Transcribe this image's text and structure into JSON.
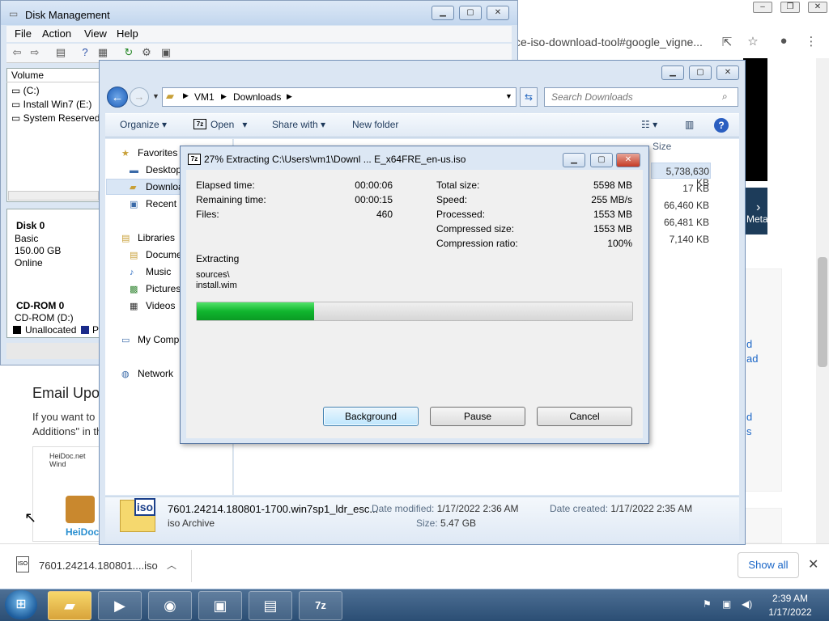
{
  "chrome": {
    "omnibox_text": "ce-iso-download-tool#google_vigne...",
    "email_heading": "Email Upo",
    "email_p1": "If you want to",
    "email_p2": "Additions\" in th",
    "heidoc_label": "HeiDoc.net Wind",
    "heidoc_logo": "HeiDoc",
    "right_links": [
      "d",
      "ad",
      "d",
      "s"
    ],
    "thumb_text": "Meta"
  },
  "download_bar": {
    "file": "7601.24214.180801....iso",
    "show_all": "Show all"
  },
  "disk_mgmt": {
    "title": "Disk Management",
    "menu": [
      "File",
      "Action",
      "View",
      "Help"
    ],
    "volume_header": "Volume",
    "volumes": [
      "(C:)",
      "Install Win7 (E:)",
      "System Reserved"
    ],
    "disk0": {
      "name": "Disk 0",
      "type": "Basic",
      "size": "150.00 GB",
      "status": "Online"
    },
    "cdrom0": {
      "name": "CD-ROM 0",
      "drive": "CD-ROM (D:)"
    },
    "legend": [
      "Unallocated",
      "P"
    ]
  },
  "explorer": {
    "breadcrumb": [
      "VM1",
      "Downloads"
    ],
    "search_placeholder": "Search Downloads",
    "commands": {
      "organize": "Organize",
      "open": "Open",
      "share": "Share with",
      "new_folder": "New folder"
    },
    "nav": [
      {
        "label": "Favorites"
      },
      {
        "label": "Desktop"
      },
      {
        "label": "Downloads"
      },
      {
        "label": "Recent Places"
      },
      {
        "label": "Libraries"
      },
      {
        "label": "Documents"
      },
      {
        "label": "Music"
      },
      {
        "label": "Pictures"
      },
      {
        "label": "Videos"
      },
      {
        "label": "My Computer"
      },
      {
        "label": "Network"
      }
    ],
    "size_header": "Size",
    "sizes": [
      "5,738,630 KB",
      "17 KB",
      "66,460 KB",
      "66,481 KB",
      "7,140 KB"
    ],
    "details": {
      "filename": "7601.24214.180801-1700.win7sp1_ldr_esc...",
      "type": "iso Archive",
      "date_modified_label": "Date modified:",
      "date_modified": "1/17/2022 2:36 AM",
      "date_created_label": "Date created:",
      "date_created": "1/17/2022 2:35 AM",
      "size_label": "Size:",
      "size": "5.47 GB"
    }
  },
  "zip": {
    "title": "27% Extracting C:\\Users\\vm1\\Downl ... E_x64FRE_en-us.iso",
    "logo": "7z",
    "stats_left": [
      {
        "label": "Elapsed time:",
        "value": "00:00:06"
      },
      {
        "label": "Remaining time:",
        "value": "00:00:15"
      },
      {
        "label": "Files:",
        "value": "460"
      }
    ],
    "stats_right": [
      {
        "label": "Total size:",
        "value": "5598 MB"
      },
      {
        "label": "Speed:",
        "value": "255 MB/s"
      },
      {
        "label": "Processed:",
        "value": "1553 MB"
      },
      {
        "label": "Compressed size:",
        "value": "1553 MB"
      },
      {
        "label": "Compression ratio:",
        "value": "100%"
      }
    ],
    "status": "Extracting",
    "path1": "sources\\",
    "path2": "install.wim",
    "progress": 0.27,
    "buttons": {
      "background": "Background",
      "pause": "Pause",
      "cancel": "Cancel"
    }
  },
  "taskbar": {
    "time": "2:39 AM",
    "date": "1/17/2022",
    "app_7z_label": "7z"
  }
}
